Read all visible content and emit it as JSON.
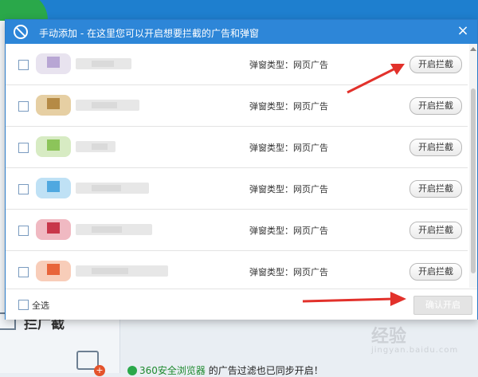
{
  "background": {
    "left_title": "拦广截",
    "sync_prefix": "",
    "sync_brand": "360安全浏览器",
    "sync_suffix": "的广告过滤也已同步开启！",
    "watermark_main": "经验",
    "watermark_sub": "jingyan.baidu.com"
  },
  "dialog": {
    "title": "手动添加 - 在这里您可以开启想要拦截的广告和弹窗",
    "close_label": "×",
    "rows": [
      {
        "type_label": "弹窗类型：网页广告",
        "button_label": "开启拦截",
        "thumb_colors": [
          "#b8a6d4",
          "#e8e3ef"
        ]
      },
      {
        "type_label": "弹窗类型：网页广告",
        "button_label": "开启拦截",
        "thumb_colors": [
          "#b58a45",
          "#e6cfa3"
        ]
      },
      {
        "type_label": "弹窗类型：网页广告",
        "button_label": "开启拦截",
        "thumb_colors": [
          "#8cc45a",
          "#d7ebc3"
        ]
      },
      {
        "type_label": "弹窗类型：网页广告",
        "button_label": "开启拦截",
        "thumb_colors": [
          "#4fa8e0",
          "#bfe1f5"
        ]
      },
      {
        "type_label": "弹窗类型：网页广告",
        "button_label": "开启拦截",
        "thumb_colors": [
          "#c8364a",
          "#f0b9c2"
        ]
      },
      {
        "type_label": "弹窗类型：网页广告",
        "button_label": "开启拦截",
        "thumb_colors": [
          "#e8643a",
          "#f8cdb9"
        ]
      }
    ],
    "select_all_label": "全选",
    "confirm_label": "确认开启"
  },
  "colors": {
    "titlebar": "#2d86d8",
    "arrow": "#e2312b"
  }
}
